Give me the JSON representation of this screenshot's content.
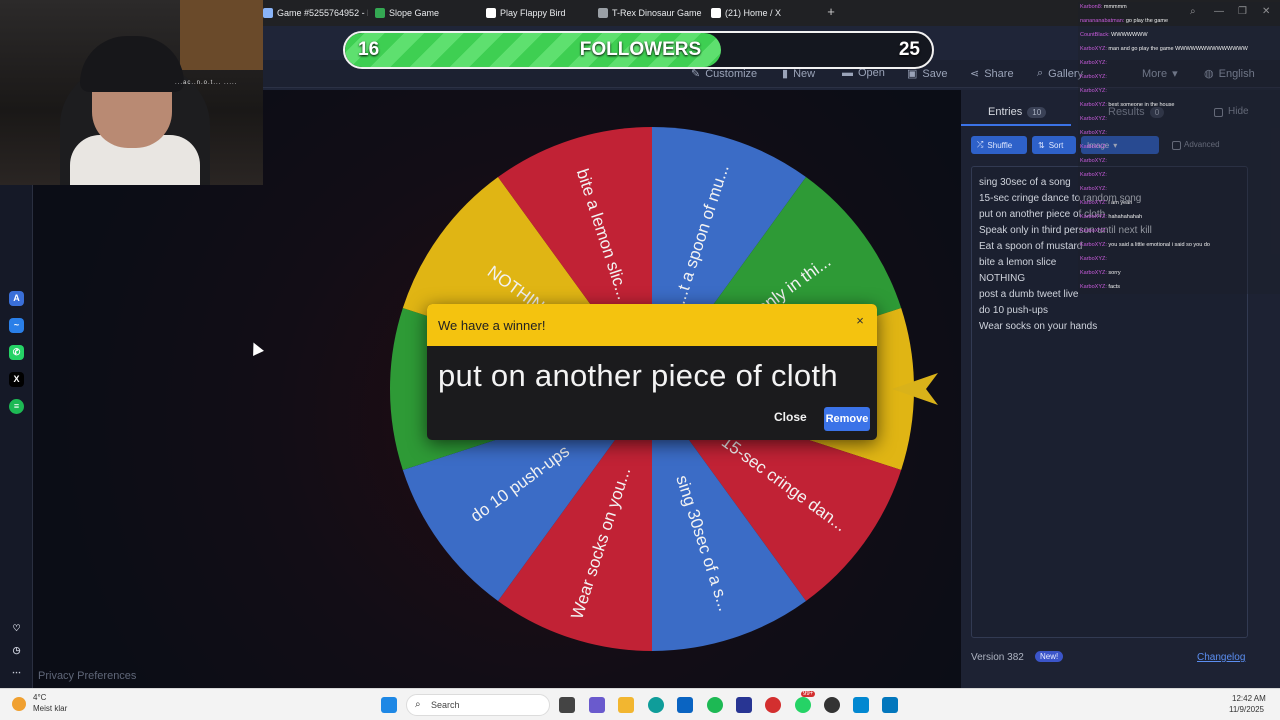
{
  "browser": {
    "tabs": [
      {
        "label": "Game #5255764952 - Min",
        "color": "#8ab4f8"
      },
      {
        "label": "Slope Game",
        "color": "#34a853"
      },
      {
        "label": "Play Flappy Bird",
        "color": "#ffffff"
      },
      {
        "label": "T-Rex Dinosaur Game - C",
        "color": "#9aa0a6"
      },
      {
        "label": "(21) Home / X",
        "color": "#ffffff"
      }
    ]
  },
  "goal": {
    "current": "16",
    "label": "FOLLOWERS",
    "target": "25",
    "fill_fraction": 0.64
  },
  "toolbar": {
    "items": [
      "Customize",
      "New",
      "Open",
      "Save",
      "Share",
      "Gallery",
      "More",
      "English"
    ]
  },
  "wheel": {
    "slices": [
      {
        "label": "...t a spoon of mu...",
        "color": "#3b6cc6"
      },
      {
        "label": "...k only in thi...",
        "color": "#2e9a36"
      },
      {
        "label": "...pi...",
        "color": "#e0b514"
      },
      {
        "label": "15-sec cringe dan...",
        "color": "#c12235"
      },
      {
        "label": "sing 30sec of a s...",
        "color": "#3b6cc6"
      },
      {
        "label": "Wear socks on you...",
        "color": "#c12235"
      },
      {
        "label": "do 10 push-ups",
        "color": "#3b6cc6"
      },
      {
        "label": "...et...",
        "color": "#2e9a36"
      },
      {
        "label": "NOTHING",
        "color": "#e0b514"
      },
      {
        "label": "bite a lemon slic...",
        "color": "#c12235"
      }
    ]
  },
  "dialog": {
    "title": "We have a winner!",
    "close_x": "×",
    "winner": "put on another piece of cloth",
    "close_label": "Close",
    "remove_label": "Remove"
  },
  "panel": {
    "entries_tab": "Entries",
    "entries_count": "10",
    "results_tab": "Results",
    "results_count": "0",
    "hide_label": "Hide",
    "shuffle_label": "Shuffle",
    "sort_label": "Sort",
    "image_label": "Image",
    "advanced_label": "Advanced",
    "entries": [
      "sing 30sec of a song",
      "15-sec cringe dance to random song",
      "put on another piece of cloth",
      "Speak only in third person until next kill",
      "Eat a spoon of mustard",
      "bite a lemon slice",
      "NOTHING",
      "post a dumb tweet live",
      "do 10 push-ups",
      "Wear socks on your hands"
    ],
    "version": "Version 382",
    "new_badge": "New!",
    "changelog": "Changelog"
  },
  "sidebar": {
    "privacy": "Privacy Preferences"
  },
  "webcam": {
    "overlay_text": "...ac..n.o.t... ....."
  },
  "chat": {
    "lines": [
      {
        "user": "Karbon8:",
        "msg": "mmmmm"
      },
      {
        "user": "nanananabatman:",
        "msg": "go play the game"
      },
      {
        "user": "CountBlack:",
        "msg": "WWWWWWW"
      },
      {
        "user": "KarboXYZ:",
        "msg": "man and go play the game WWWWWWWWWWWWWW"
      },
      {
        "user": "KarboXYZ:",
        "msg": ""
      },
      {
        "user": "KarboXYZ:",
        "msg": ""
      },
      {
        "user": "KarboXYZ:",
        "msg": ""
      },
      {
        "user": "KarboXYZ:",
        "msg": "best someone in the house"
      },
      {
        "user": "KarboXYZ:",
        "msg": ""
      },
      {
        "user": "KarboXYZ:",
        "msg": ""
      },
      {
        "user": "KarboXYZ:",
        "msg": ""
      },
      {
        "user": "KarboXYZ:",
        "msg": ""
      },
      {
        "user": "KarboXYZ:",
        "msg": ""
      },
      {
        "user": "KarboXYZ:",
        "msg": ""
      },
      {
        "user": "KarboXYZ:",
        "msg": "i am yeah"
      },
      {
        "user": "KarboXYZ:",
        "msg": "hahahahahah"
      },
      {
        "user": "KarboXYZ:",
        "msg": ""
      },
      {
        "user": "KarboXYZ:",
        "msg": "you said a little emotional i said so you do"
      },
      {
        "user": "KarboXYZ:",
        "msg": ""
      },
      {
        "user": "KarboXYZ:",
        "msg": "sorry"
      },
      {
        "user": "KarboXYZ:",
        "msg": "facts"
      }
    ]
  },
  "taskbar": {
    "temp": "4°C",
    "weather": "Meist klar",
    "search_placeholder": "Search",
    "time": "12:42 AM",
    "date": "11/9/2025",
    "notification_badge": "99+"
  }
}
